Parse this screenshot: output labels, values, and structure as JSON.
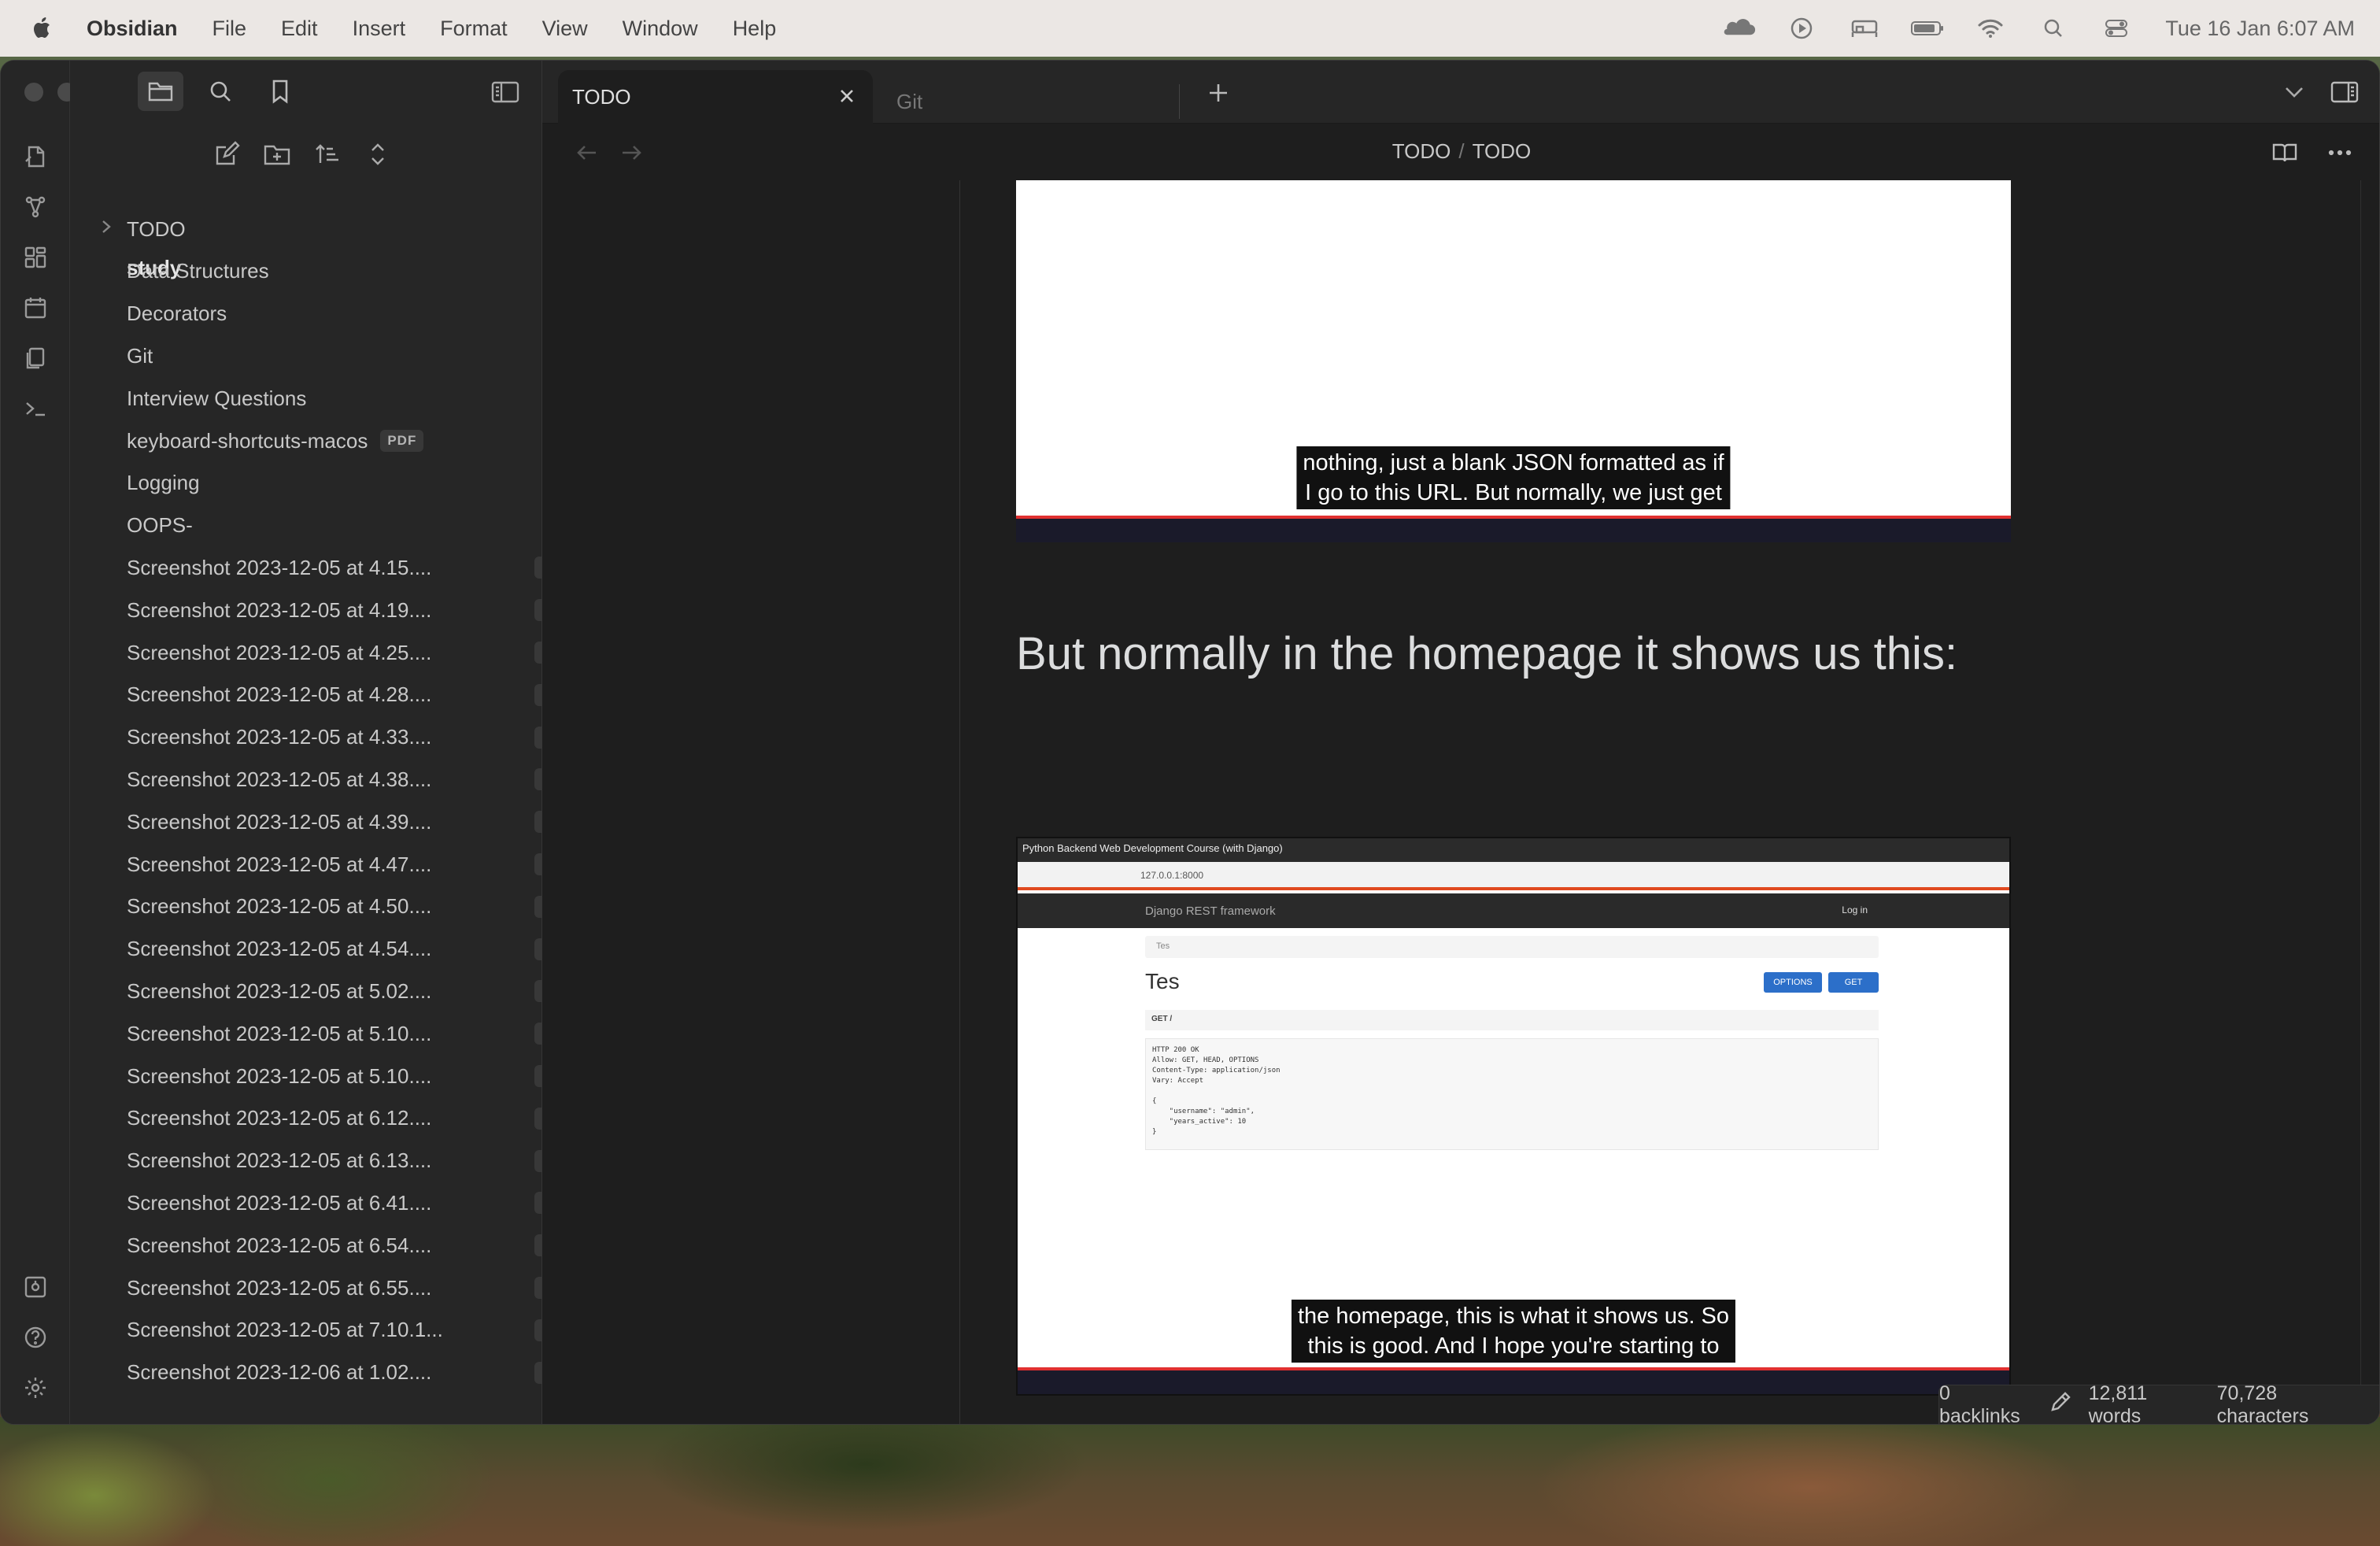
{
  "menubar": {
    "app_name": "Obsidian",
    "items": [
      "File",
      "Edit",
      "Insert",
      "Format",
      "View",
      "Window",
      "Help"
    ],
    "clock": "Tue 16 Jan  6:07 AM",
    "status_icons": [
      "cloud-icon",
      "play-circle-icon",
      "bed-icon",
      "battery-icon",
      "wifi-icon",
      "search-icon",
      "control-center-icon"
    ]
  },
  "sidebar": {
    "vault": "study",
    "items": [
      {
        "label": "TODO",
        "type": "folder"
      },
      {
        "label": "Data Structures"
      },
      {
        "label": "Decorators"
      },
      {
        "label": "Git"
      },
      {
        "label": "Interview Questions"
      },
      {
        "label": "keyboard-shortcuts-macos",
        "badge": "PDF"
      },
      {
        "label": "Logging"
      },
      {
        "label": "OOPS-"
      },
      {
        "label": "Screenshot 2023-12-05 at 4.15....",
        "badge": "PNG"
      },
      {
        "label": "Screenshot 2023-12-05 at 4.19....",
        "badge": "PNG"
      },
      {
        "label": "Screenshot 2023-12-05 at 4.25....",
        "badge": "PNG"
      },
      {
        "label": "Screenshot 2023-12-05 at 4.28....",
        "badge": "PNG"
      },
      {
        "label": "Screenshot 2023-12-05 at 4.33....",
        "badge": "PNG"
      },
      {
        "label": "Screenshot 2023-12-05 at 4.38....",
        "badge": "PNG"
      },
      {
        "label": "Screenshot 2023-12-05 at 4.39....",
        "badge": "PNG"
      },
      {
        "label": "Screenshot 2023-12-05 at 4.47....",
        "badge": "PNG"
      },
      {
        "label": "Screenshot 2023-12-05 at 4.50....",
        "badge": "PNG"
      },
      {
        "label": "Screenshot 2023-12-05 at 4.54....",
        "badge": "PNG"
      },
      {
        "label": "Screenshot 2023-12-05 at 5.02....",
        "badge": "PNG"
      },
      {
        "label": "Screenshot 2023-12-05 at 5.10....",
        "badge": "PNG"
      },
      {
        "label": "Screenshot 2023-12-05 at 5.10....",
        "badge": "PNG"
      },
      {
        "label": "Screenshot 2023-12-05 at 6.12....",
        "badge": "PNG"
      },
      {
        "label": "Screenshot 2023-12-05 at 6.13....",
        "badge": "PNG"
      },
      {
        "label": "Screenshot 2023-12-05 at 6.41....",
        "badge": "PNG"
      },
      {
        "label": "Screenshot 2023-12-05 at 6.54....",
        "badge": "PNG"
      },
      {
        "label": "Screenshot 2023-12-05 at 6.55....",
        "badge": "PNG"
      },
      {
        "label": "Screenshot 2023-12-05 at 7.10.1...",
        "badge": "PNG"
      },
      {
        "label": "Screenshot 2023-12-06 at 1.02....",
        "badge": "PNG"
      }
    ]
  },
  "tabs": [
    {
      "label": "TODO",
      "active": true
    },
    {
      "label": "Git",
      "active": false
    }
  ],
  "view_header": {
    "breadcrumb": [
      "TODO",
      "TODO"
    ],
    "separator": "/"
  },
  "content": {
    "video1": {
      "caption_line1": "nothing, just a blank JSON formatted as if",
      "caption_line2": "I go to this URL. But normally, we just get"
    },
    "heading": "But normally in the homepage it shows us this:",
    "video2": {
      "browser_title": "Python Backend Web Development Course (with Django)",
      "url": "127.0.0.1:8000",
      "brand": "Django REST framework",
      "login": "Log in",
      "crumb": "Tes",
      "title": "Tes",
      "options_btn": "OPTIONS",
      "get_btn": "GET",
      "get_req": "GET /",
      "response": "HTTP 200 OK\nAllow: GET, HEAD, OPTIONS\nContent-Type: application/json\nVary: Accept\n\n{\n    \"username\": \"admin\",\n    \"years_active\": 10\n}",
      "caption_line1": "the homepage, this is what it shows us. So",
      "caption_line2": "this is good. And I hope you're starting to"
    }
  },
  "statusbar": {
    "backlinks": "0 backlinks",
    "words": "12,811 words",
    "characters": "70,728 characters"
  },
  "colors": {
    "background": "#1e1e1e",
    "sidebar": "#262626",
    "text": "#dcddde",
    "accent_red": "#e03030"
  }
}
